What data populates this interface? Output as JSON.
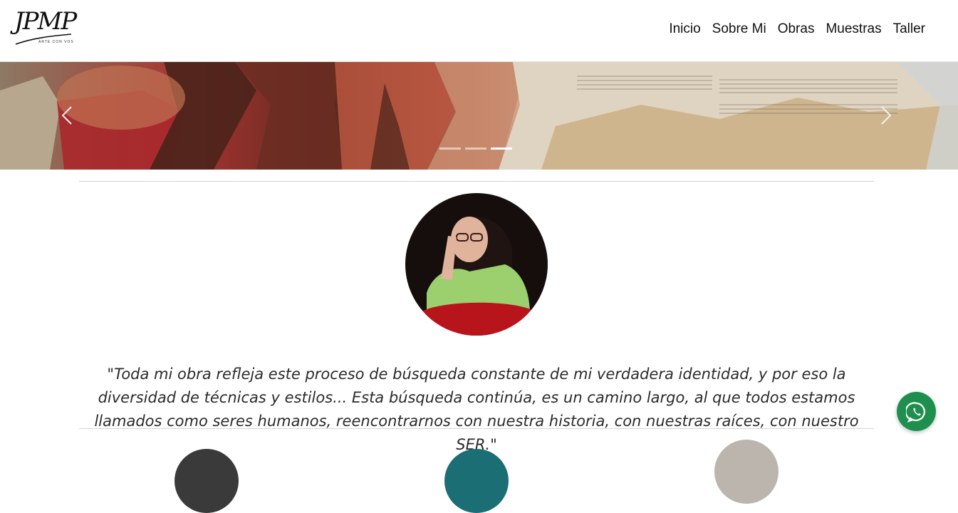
{
  "brand": {
    "logo_text": "JPMP",
    "logo_tagline": "ARTE CON VOS"
  },
  "nav": {
    "items": [
      {
        "label": "Inicio"
      },
      {
        "label": "Sobre Mi"
      },
      {
        "label": "Obras"
      },
      {
        "label": "Muestras"
      },
      {
        "label": "Taller"
      }
    ]
  },
  "carousel": {
    "slide_count": 3,
    "active_index": 2,
    "prev_icon": "chevron-left-icon",
    "next_icon": "chevron-right-icon"
  },
  "about": {
    "quote": "\"Toda mi obra refleja este proceso de búsqueda constante de mi verdadera identidad, y por eso la diversidad de técnicas y estilos... Esta búsqueda continúa, es un camino largo, al que todos estamos llamados como seres humanos, reencontrarnos con nuestra historia, con nuestras raíces, con nuestro SER.\""
  },
  "floating": {
    "whatsapp_icon": "whatsapp-icon",
    "whatsapp_color": "#1f8f4e"
  }
}
